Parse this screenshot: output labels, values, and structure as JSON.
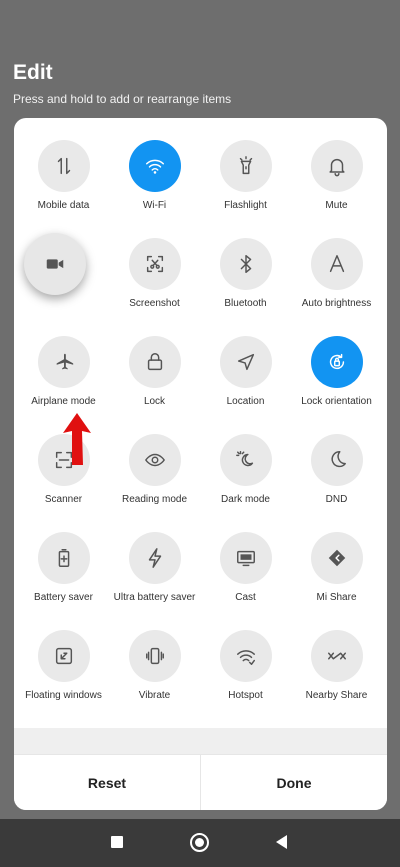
{
  "header": {
    "title": "Edit",
    "subtitle": "Press and hold to add or rearrange items"
  },
  "tiles": [
    {
      "label": "Mobile data",
      "icon": "mobile-data-icon",
      "active": false
    },
    {
      "label": "Wi-Fi",
      "icon": "wifi-icon",
      "active": true
    },
    {
      "label": "Flashlight",
      "icon": "flashlight-icon",
      "active": false
    },
    {
      "label": "Mute",
      "icon": "bell-icon",
      "active": false
    },
    {
      "label": "",
      "icon": "video-camera-icon",
      "active": false,
      "dragging": true
    },
    {
      "label": "Screenshot",
      "icon": "screenshot-icon",
      "active": false
    },
    {
      "label": "Bluetooth",
      "icon": "bluetooth-icon",
      "active": false
    },
    {
      "label": "Auto brightness",
      "icon": "auto-brightness-icon",
      "active": false
    },
    {
      "label": "Airplane mode",
      "icon": "airplane-icon",
      "active": false
    },
    {
      "label": "Lock",
      "icon": "lock-icon",
      "active": false
    },
    {
      "label": "Location",
      "icon": "location-icon",
      "active": false
    },
    {
      "label": "Lock orientation",
      "icon": "lock-orientation-icon",
      "active": true
    },
    {
      "label": "Scanner",
      "icon": "scanner-icon",
      "active": false
    },
    {
      "label": "Reading mode",
      "icon": "eye-icon",
      "active": false
    },
    {
      "label": "Dark mode",
      "icon": "dark-mode-icon",
      "active": false
    },
    {
      "label": "DND",
      "icon": "moon-icon",
      "active": false
    },
    {
      "label": "Battery saver",
      "icon": "battery-saver-icon",
      "active": false
    },
    {
      "label": "Ultra battery saver",
      "icon": "lightning-icon",
      "active": false
    },
    {
      "label": "Cast",
      "icon": "cast-icon",
      "active": false
    },
    {
      "label": "Mi Share",
      "icon": "mi-share-icon",
      "active": false
    },
    {
      "label": "Floating windows",
      "icon": "floating-windows-icon",
      "active": false
    },
    {
      "label": "Vibrate",
      "icon": "vibrate-icon",
      "active": false
    },
    {
      "label": "Hotspot",
      "icon": "hotspot-icon",
      "active": false
    },
    {
      "label": "Nearby Share",
      "icon": "nearby-share-icon",
      "active": false
    }
  ],
  "buttons": {
    "reset": "Reset",
    "done": "Done"
  },
  "navbar": {
    "icons": [
      "recents-icon",
      "home-icon",
      "back-icon"
    ]
  },
  "colors": {
    "active": "#1294f2",
    "tile_bg": "#e9e9e9",
    "backdrop": "#6e6e6e",
    "arrow": "#e01010"
  }
}
